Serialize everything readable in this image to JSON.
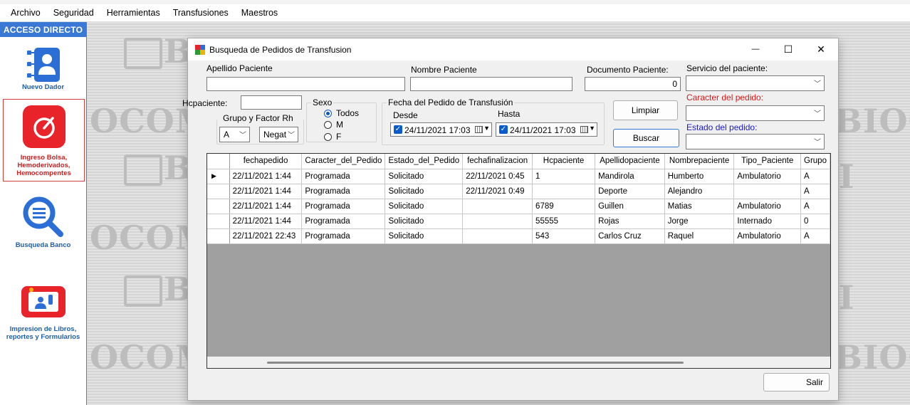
{
  "menu": [
    "Archivo",
    "Seguridad",
    "Herramientas",
    "Transfusiones",
    "Maestros"
  ],
  "sidebar": {
    "title": "ACCESO DIRECTO",
    "items": [
      {
        "label": "Nuevo Dador",
        "color": "#1f5fa8"
      },
      {
        "label": "Ingreso Bolsa, Hemoderivados, Hemocompentes",
        "color": "#cc1f1f"
      },
      {
        "label": "Busqueda Banco",
        "color": "#1f5fa8"
      },
      {
        "label": "Impresion de Libros, reportes y Formularios",
        "color": "#1f5fa8"
      }
    ]
  },
  "background": {
    "watermark_left": "OCOM",
    "watermark_right": "BIOC",
    "watermark_partial": "B",
    "watermark_partial_right": "I"
  },
  "dialog": {
    "title": "Busqueda de Pedidos de Transfusion",
    "controls": {
      "minimize": "—",
      "maximize": "☐",
      "close": "✕"
    },
    "apellido_label": "Apellido Paciente",
    "apellido_value": "",
    "nombre_label": "Nombre Paciente",
    "nombre_value": "",
    "documento_label": "Documento Paciente:",
    "documento_value": "0",
    "servicio_label": "Servicio del paciente:",
    "servicio_value": "",
    "caracter_label": "Caracter del pedido:",
    "caracter_value": "",
    "estado_label": "Estado del pedido:",
    "estado_value": "",
    "hcpaciente_label": "Hcpaciente:",
    "hcpaciente_value": "",
    "grupo_label": "Grupo y  Factor Rh",
    "grupo_value": "A",
    "factor_value": "Negat",
    "sexo_label": "Sexo",
    "sexo_options": [
      "Todos",
      "M",
      "F"
    ],
    "sexo_selected": "Todos",
    "fecha_group_label": "Fecha del Pedido de Transfusión",
    "desde_label": "Desde",
    "desde_value": "24/11/2021 17:03",
    "hasta_label": "Hasta",
    "hasta_value": "24/11/2021 17:03",
    "limpiar_label": "Limpiar",
    "buscar_label": "Buscar",
    "salir_label": "Salir",
    "label_colors": {
      "caracter": "#d11a1a",
      "estado": "#1a1acd"
    }
  },
  "grid": {
    "columns": [
      "fechapedido",
      "Caracter_del_Pedido",
      "Estado_del_Pedido",
      "fechafinalizacion",
      "Hcpaciente",
      "Apellidopaciente",
      "Nombrepaciente",
      "Tipo_Paciente",
      "Grupo"
    ],
    "rows": [
      [
        "22/11/2021 1:44",
        "Programada",
        "Solicitado",
        "22/11/2021 0:45",
        "1",
        "Mandirola",
        "Humberto",
        "Ambulatorio",
        "A"
      ],
      [
        "22/11/2021 1:44",
        "Programada",
        "Solicitado",
        "22/11/2021 0:49",
        "",
        "Deporte",
        "Alejandro",
        "",
        "A"
      ],
      [
        "22/11/2021 1:44",
        "Programada",
        "Solicitado",
        "",
        "6789",
        "Guillen",
        "Matias",
        "Ambulatorio",
        "A"
      ],
      [
        "22/11/2021 1:44",
        "Programada",
        "Solicitado",
        "",
        "55555",
        "Rojas",
        "Jorge",
        "Internado",
        "0"
      ],
      [
        "22/11/2021 22:43",
        "Programada",
        "Solicitado",
        "",
        "543",
        "Carlos Cruz",
        "Raquel",
        "Ambulatorio",
        "A"
      ]
    ],
    "current_row_marker": "▶"
  }
}
